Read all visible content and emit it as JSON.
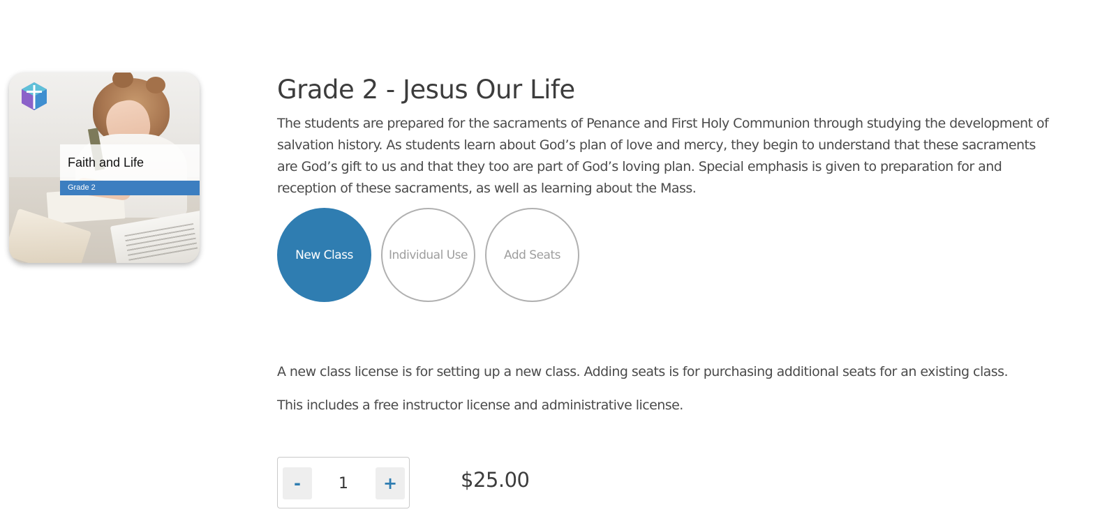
{
  "product": {
    "cover": {
      "title": "Faith and Life",
      "grade": "Grade 2",
      "icon": "cross-logo-icon"
    },
    "title": "Grade 2 - Jesus Our Life",
    "description": "The students are prepared for the sacraments of Penance and First Holy Communion through studying the development of salvation history. As students learn about God’s plan of love and mercy, they begin to understand that these sacraments are God’s gift to us and that they too are part of God’s loving plan. Special emphasis is given to preparation for and reception of these sacraments, as well as learning about the Mass."
  },
  "license_options": {
    "selected": "New Class",
    "items": [
      {
        "label": "New Class"
      },
      {
        "label": "Individual Use"
      },
      {
        "label": "Add Seats"
      }
    ]
  },
  "notes": {
    "line1": "A new class license is for setting up a new class. Adding seats is for purchasing additional seats for an existing class.",
    "line2": "This includes a free instructor license and administrative license."
  },
  "quantity": {
    "decrement_label": "-",
    "value": "1",
    "increment_label": "+"
  },
  "price": "$25.00",
  "colors": {
    "accent": "#2f7db1",
    "cover_band": "#3c7ec0",
    "inactive_border": "#b0b0b0",
    "inactive_text": "#9e9e9e",
    "text": "#3c3c3c"
  }
}
